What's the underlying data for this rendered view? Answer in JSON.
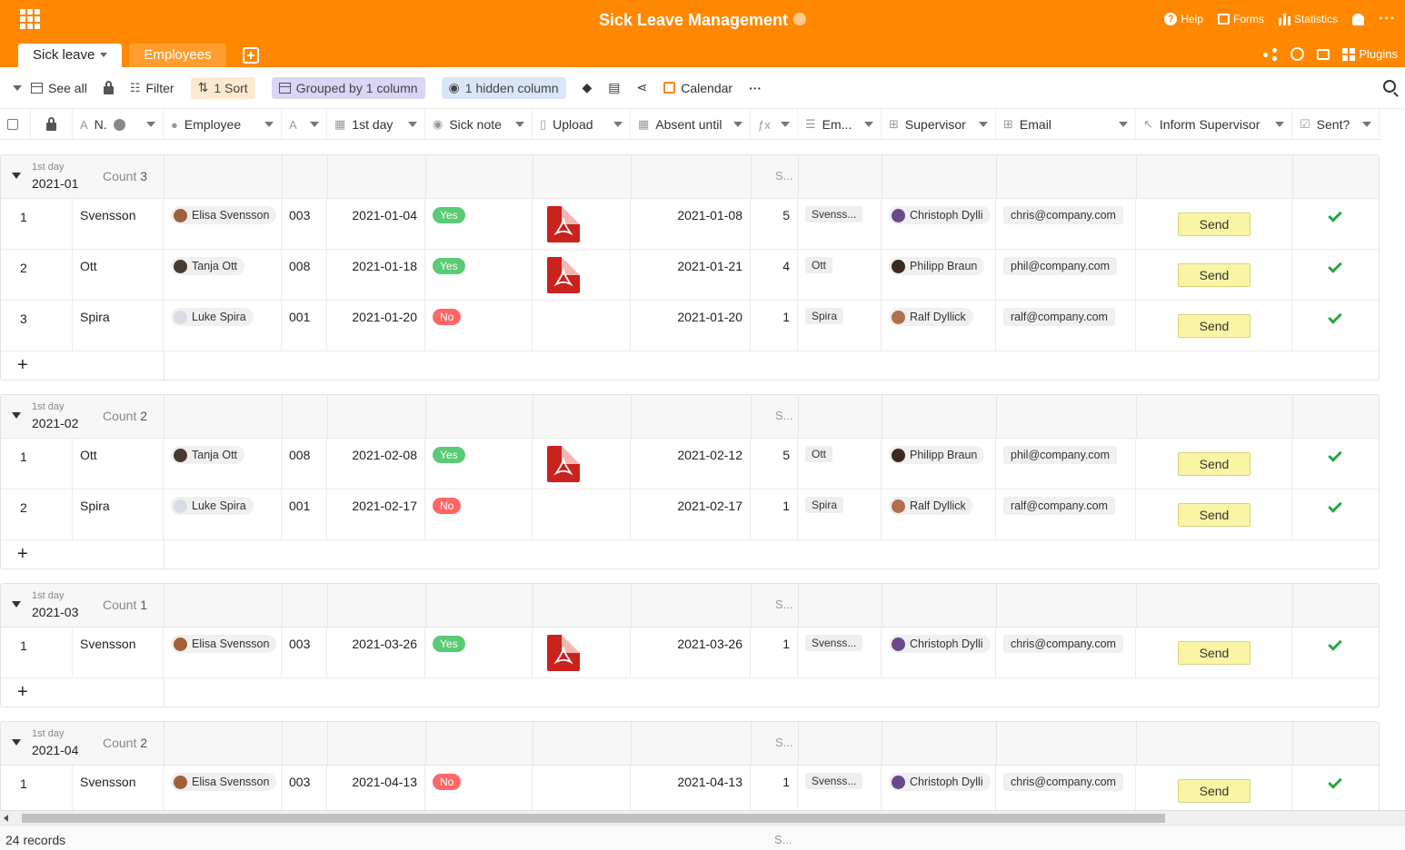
{
  "app": {
    "title": "Sick Leave Management",
    "top_actions": [
      "Help",
      "Forms",
      "Statistics"
    ],
    "tabs": [
      {
        "label": "Sick leave",
        "active": true
      },
      {
        "label": "Employees",
        "active": false
      }
    ],
    "plugins_label": "Plugins",
    "accent_color": "#ff8800"
  },
  "toolbar": {
    "see_all": "See all",
    "filter": "Filter",
    "sort": "1 Sort",
    "grouped": "Grouped by 1 column",
    "hidden": "1 hidden column",
    "calendar": "Calendar"
  },
  "columns": [
    {
      "key": "check",
      "label": "",
      "icon": ""
    },
    {
      "key": "lock",
      "label": "",
      "icon": "lock-icon"
    },
    {
      "key": "n",
      "label": "N.",
      "icon": "text-icon"
    },
    {
      "key": "employee",
      "label": "Employee",
      "icon": "person-icon"
    },
    {
      "key": "a",
      "label": "",
      "icon": "text-icon"
    },
    {
      "key": "first_day",
      "label": "1st day",
      "icon": "calendar-icon"
    },
    {
      "key": "sick_note",
      "label": "Sick note",
      "icon": "single-select-icon"
    },
    {
      "key": "upload",
      "label": "Upload",
      "icon": "file-icon"
    },
    {
      "key": "absent_until",
      "label": "Absent until",
      "icon": "calendar-icon"
    },
    {
      "key": "fx",
      "label": "",
      "icon": "formula-icon"
    },
    {
      "key": "em",
      "label": "Em...",
      "icon": "long-text-icon"
    },
    {
      "key": "supervisor",
      "label": "Supervisor",
      "icon": "link-icon"
    },
    {
      "key": "email",
      "label": "Email",
      "icon": "link-icon"
    },
    {
      "key": "inform",
      "label": "Inform Supervisor",
      "icon": "button-icon"
    },
    {
      "key": "sent",
      "label": "Sent?",
      "icon": "checkbox-icon"
    }
  ],
  "groups": [
    {
      "label": "1st day",
      "value": "2021-01",
      "count_label": "Count",
      "count": "3",
      "summary": "S...",
      "rows": [
        {
          "idx": "1",
          "name": "Svensson",
          "employee": "Elisa Svensson",
          "avatar": "#a0603a",
          "id": "003",
          "first_day": "2021-01-04",
          "sick_note": "Yes",
          "upload": true,
          "absent_until": "2021-01-08",
          "days": "5",
          "em": "Svenss...",
          "supervisor": "Christoph Dylli",
          "sup_avatar": "#6a4a8a",
          "email": "chris@company.com",
          "send": "Send",
          "sent": true
        },
        {
          "idx": "2",
          "name": "Ott",
          "employee": "Tanja Ott",
          "avatar": "#4a3a30",
          "id": "008",
          "first_day": "2021-01-18",
          "sick_note": "Yes",
          "upload": true,
          "absent_until": "2021-01-21",
          "days": "4",
          "em": "Ott",
          "supervisor": "Philipp Braun",
          "sup_avatar": "#3a2a20",
          "email": "phil@company.com",
          "send": "Send",
          "sent": true
        },
        {
          "idx": "3",
          "name": "Spira",
          "employee": "Luke Spira",
          "avatar": "#d9dde3",
          "id": "001",
          "first_day": "2021-01-20",
          "sick_note": "No",
          "upload": false,
          "absent_until": "2021-01-20",
          "days": "1",
          "em": "Spira",
          "supervisor": "Ralf Dyllick",
          "sup_avatar": "#b07050",
          "email": "ralf@company.com",
          "send": "Send",
          "sent": true
        }
      ]
    },
    {
      "label": "1st day",
      "value": "2021-02",
      "count_label": "Count",
      "count": "2",
      "summary": "S...",
      "rows": [
        {
          "idx": "1",
          "name": "Ott",
          "employee": "Tanja Ott",
          "avatar": "#4a3a30",
          "id": "008",
          "first_day": "2021-02-08",
          "sick_note": "Yes",
          "upload": true,
          "absent_until": "2021-02-12",
          "days": "5",
          "em": "Ott",
          "supervisor": "Philipp Braun",
          "sup_avatar": "#3a2a20",
          "email": "phil@company.com",
          "send": "Send",
          "sent": true
        },
        {
          "idx": "2",
          "name": "Spira",
          "employee": "Luke Spira",
          "avatar": "#d9dde3",
          "id": "001",
          "first_day": "2021-02-17",
          "sick_note": "No",
          "upload": false,
          "absent_until": "2021-02-17",
          "days": "1",
          "em": "Spira",
          "supervisor": "Ralf Dyllick",
          "sup_avatar": "#b07050",
          "email": "ralf@company.com",
          "send": "Send",
          "sent": true
        }
      ]
    },
    {
      "label": "1st day",
      "value": "2021-03",
      "count_label": "Count",
      "count": "1",
      "summary": "S...",
      "rows": [
        {
          "idx": "1",
          "name": "Svensson",
          "employee": "Elisa Svensson",
          "avatar": "#a0603a",
          "id": "003",
          "first_day": "2021-03-26",
          "sick_note": "Yes",
          "upload": true,
          "absent_until": "2021-03-26",
          "days": "1",
          "em": "Svenss...",
          "supervisor": "Christoph Dylli",
          "sup_avatar": "#6a4a8a",
          "email": "chris@company.com",
          "send": "Send",
          "sent": true
        }
      ]
    },
    {
      "label": "1st day",
      "value": "2021-04",
      "count_label": "Count",
      "count": "2",
      "summary": "S...",
      "rows": [
        {
          "idx": "1",
          "name": "Svensson",
          "employee": "Elisa Svensson",
          "avatar": "#a0603a",
          "id": "003",
          "first_day": "2021-04-13",
          "sick_note": "No",
          "upload": false,
          "absent_until": "2021-04-13",
          "days": "1",
          "em": "Svenss...",
          "supervisor": "Christoph Dylli",
          "sup_avatar": "#6a4a8a",
          "email": "chris@company.com",
          "send": "Send",
          "sent": true
        }
      ]
    }
  ],
  "footer": {
    "records": "24 records",
    "summary": "S..."
  }
}
